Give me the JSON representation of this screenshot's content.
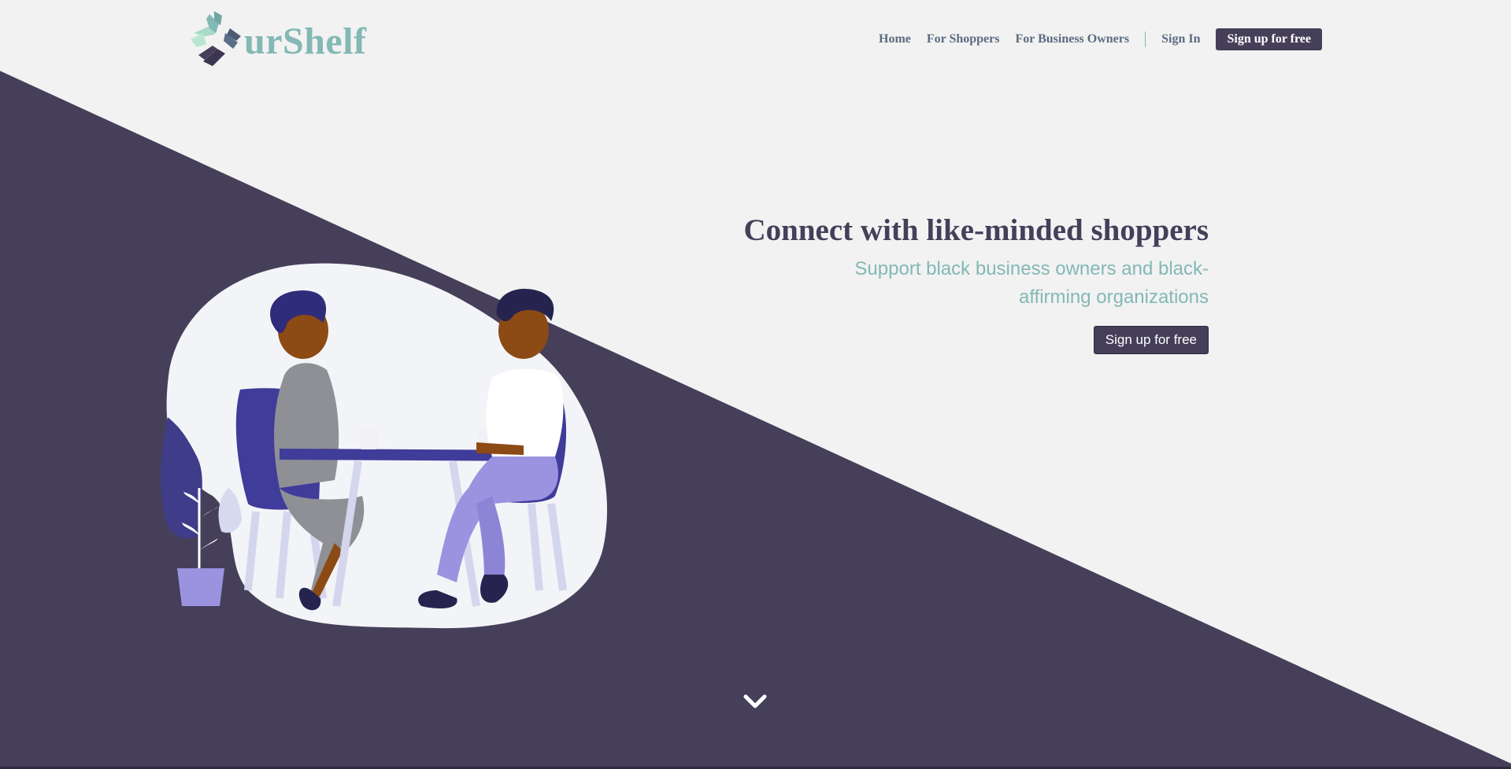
{
  "brand": {
    "logo_text": "urShelf",
    "colors": {
      "primary": "#463f5a",
      "accent": "#83b8b4",
      "background": "#f2f2f2",
      "nav_text": "#5b6c82"
    }
  },
  "nav": {
    "items": [
      {
        "label": "Home"
      },
      {
        "label": "For Shoppers"
      },
      {
        "label": "For Business Owners"
      }
    ],
    "sign_in": "Sign In",
    "sign_up": "Sign up for free"
  },
  "hero": {
    "title": "Connect with like-minded shoppers",
    "subtitle": "Support black business owners and black-affirming organizations",
    "cta": "Sign up for free"
  },
  "icons": {
    "logo_mark": "hands-circle-icon",
    "scroll_down": "chevron-down-icon"
  }
}
